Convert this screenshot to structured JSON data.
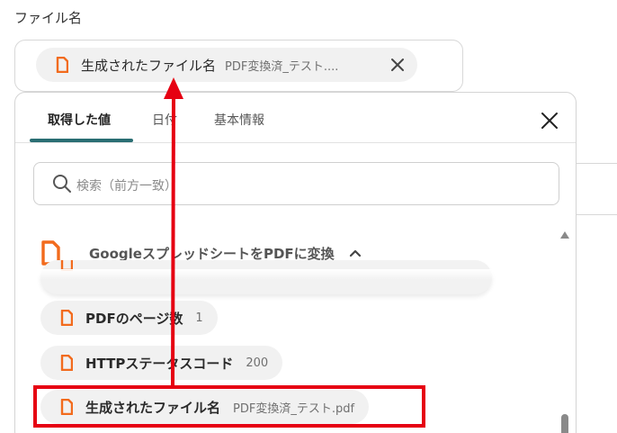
{
  "field": {
    "label": "ファイル名",
    "selected_chip": {
      "label": "生成されたファイル名",
      "value": "PDF変換済_テスト...."
    }
  },
  "dropdown": {
    "tabs": [
      {
        "label": "取得した値",
        "active": true
      },
      {
        "label": "日付",
        "active": false
      },
      {
        "label": "基本情報",
        "active": false
      }
    ],
    "search_placeholder": "検索（前方一致）",
    "section_title": "GoogleスプレッドシートをPDFに変換",
    "items": [
      {
        "label": "PDFのページ数",
        "value": "1"
      },
      {
        "label": "HTTPステータスコード",
        "value": "200"
      },
      {
        "label": "生成されたファイル名",
        "value": "PDF変換済_テスト.pdf",
        "highlighted": true
      }
    ]
  },
  "colors": {
    "accent_tab": "#2a6e73",
    "annotation": "#e60012",
    "icon_orange": "#f26b1d"
  },
  "icons": {
    "item_icon": "document-icon",
    "search_icon": "search-icon",
    "close_icon": "close-icon",
    "collapse_icon": "chevron-up-icon"
  }
}
